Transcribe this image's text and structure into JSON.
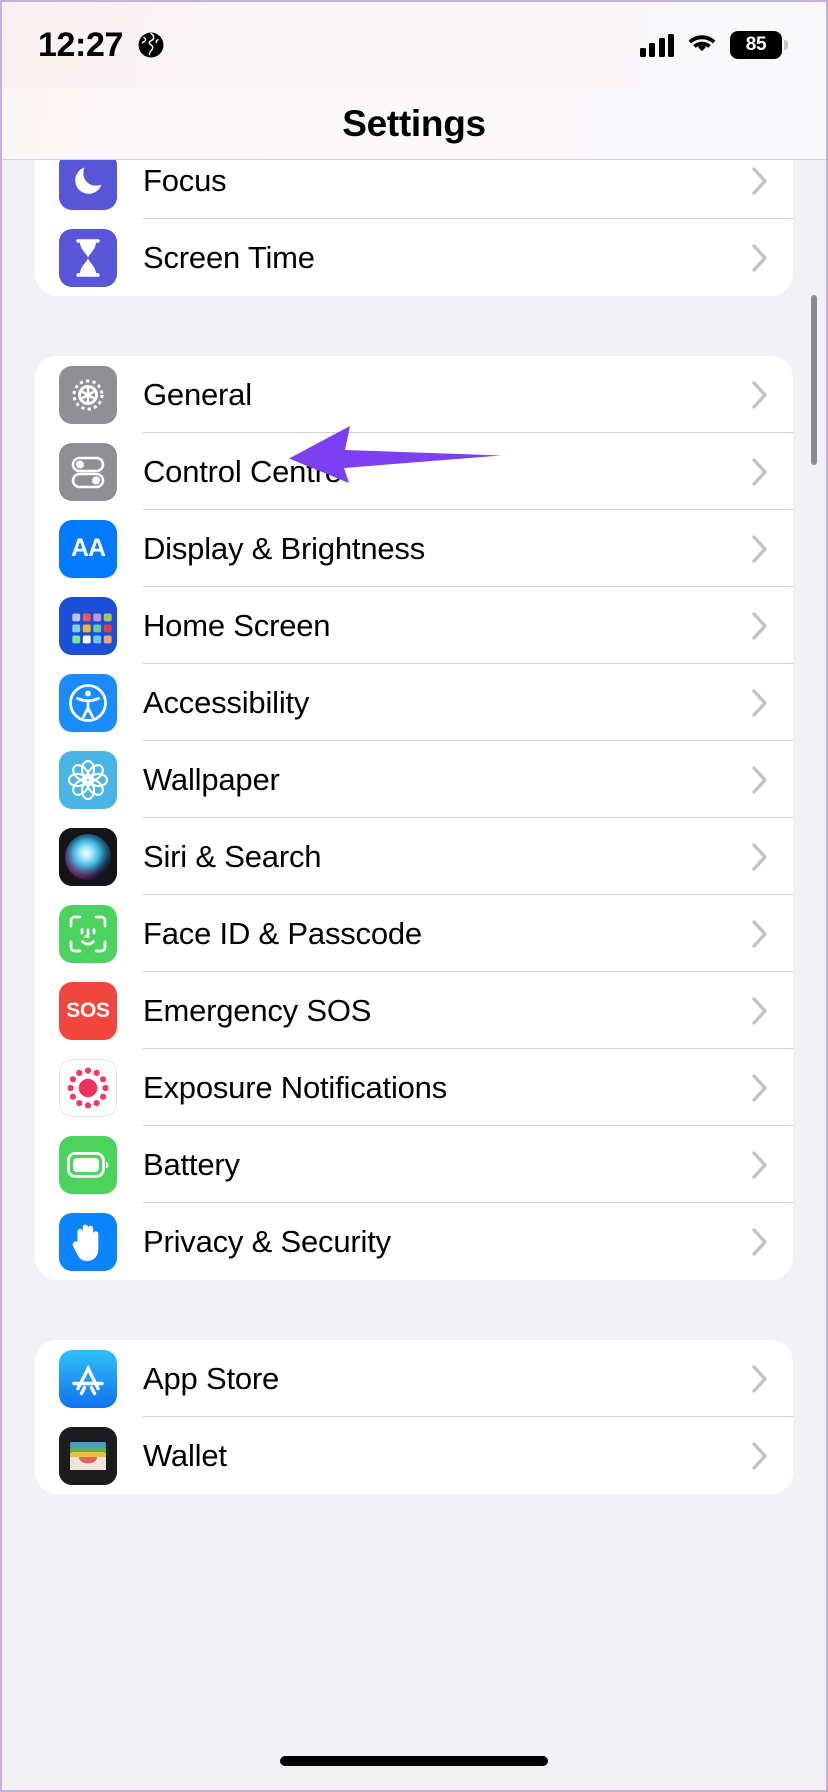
{
  "status_bar": {
    "time": "12:27",
    "location_icon": "globe-icon",
    "signal_icon": "cellular-signal-icon",
    "wifi_icon": "wifi-icon",
    "battery_level": "85"
  },
  "nav": {
    "title": "Settings"
  },
  "annotation": {
    "type": "arrow-pointer",
    "color": "#7d3ff2",
    "points_to": "General",
    "direction": "left"
  },
  "scrollbar": {
    "visible": true,
    "color": "#8a8a92"
  },
  "groups": [
    {
      "name": "focus-group",
      "clipped_top": true,
      "rows": [
        {
          "label": "Focus",
          "icon": "moon-icon",
          "icon_bg": "#5856d6",
          "chevron": "chevron-right-icon"
        },
        {
          "label": "Screen Time",
          "icon": "hourglass-icon",
          "icon_bg": "#5856d6",
          "chevron": "chevron-right-icon"
        }
      ]
    },
    {
      "name": "system-group",
      "clipped_top": false,
      "rows": [
        {
          "label": "General",
          "icon": "gear-icon",
          "icon_bg": "#8e8e93",
          "chevron": "chevron-right-icon",
          "annotated": true
        },
        {
          "label": "Control Centre",
          "icon": "toggles-icon",
          "icon_bg": "#8e8e93",
          "chevron": "chevron-right-icon"
        },
        {
          "label": "Display & Brightness",
          "icon": "aa-text-icon",
          "icon_bg": "#007aff",
          "chevron": "chevron-right-icon"
        },
        {
          "label": "Home Screen",
          "icon": "app-grid-icon",
          "icon_bg": "#1d4ed8",
          "chevron": "chevron-right-icon"
        },
        {
          "label": "Accessibility",
          "icon": "accessibility-icon",
          "icon_bg": "#1a8cff",
          "chevron": "chevron-right-icon"
        },
        {
          "label": "Wallpaper",
          "icon": "flower-icon",
          "icon_bg": "#4bb4e6",
          "chevron": "chevron-right-icon"
        },
        {
          "label": "Siri & Search",
          "icon": "siri-orb-icon",
          "icon_bg": "#17171c",
          "chevron": "chevron-right-icon"
        },
        {
          "label": "Face ID & Passcode",
          "icon": "face-id-icon",
          "icon_bg": "#4cd35f",
          "chevron": "chevron-right-icon"
        },
        {
          "label": "Emergency SOS",
          "icon": "sos-icon",
          "icon_bg": "#f1453d",
          "chevron": "chevron-right-icon"
        },
        {
          "label": "Exposure Notifications",
          "icon": "exposure-dots-icon",
          "icon_bg": "#ffffff",
          "chevron": "chevron-right-icon"
        },
        {
          "label": "Battery",
          "icon": "battery-icon",
          "icon_bg": "#4cd35f",
          "chevron": "chevron-right-icon"
        },
        {
          "label": "Privacy & Security",
          "icon": "hand-icon",
          "icon_bg": "#0a84ff",
          "chevron": "chevron-right-icon"
        }
      ]
    },
    {
      "name": "store-group",
      "clipped_top": false,
      "rows": [
        {
          "label": "App Store",
          "icon": "app-store-icon",
          "icon_bg": "#1d9bf6",
          "chevron": "chevron-right-icon"
        },
        {
          "label": "Wallet",
          "icon": "wallet-icon",
          "icon_bg": "#1c1c1e",
          "chevron": "chevron-right-icon"
        }
      ]
    }
  ]
}
